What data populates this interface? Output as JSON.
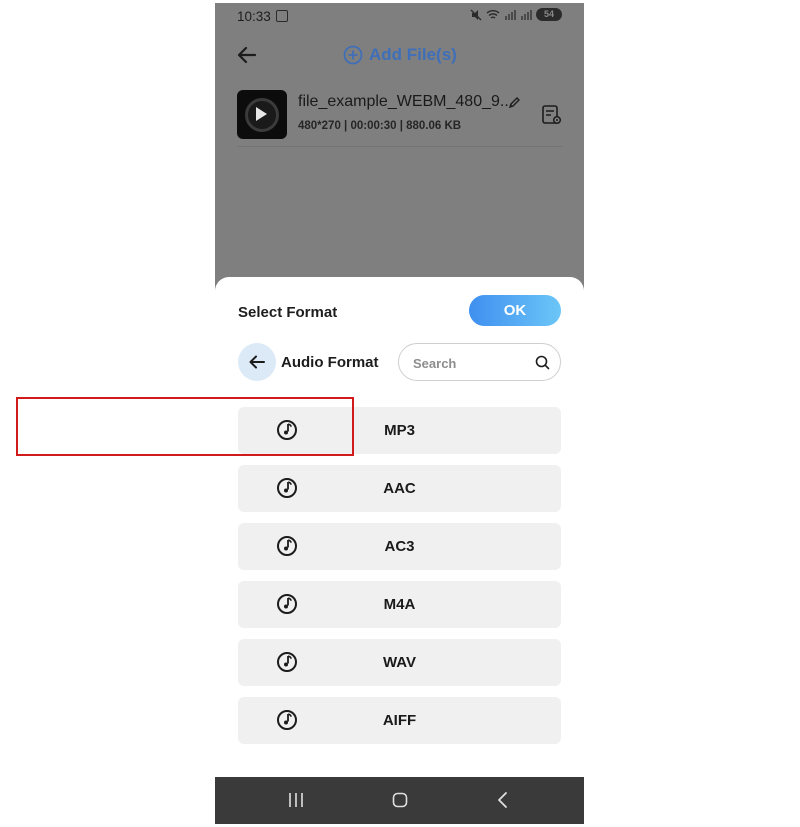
{
  "status_bar": {
    "time": "10:33",
    "battery": "54"
  },
  "header": {
    "add_files_label": "Add File(s)"
  },
  "file": {
    "name": "file_example_WEBM_480_9...",
    "resolution": "480*270",
    "duration": "00:00:30",
    "size": "880.06 KB",
    "meta_separator": " | "
  },
  "sheet": {
    "title": "Select Format",
    "ok_label": "OK",
    "category": "Audio Format",
    "search_placeholder": "Search"
  },
  "formats": [
    {
      "label": "MP3",
      "icon": "music-disc-icon",
      "selected": true
    },
    {
      "label": "AAC",
      "icon": "music-disc-icon"
    },
    {
      "label": "AC3",
      "icon": "music-disc-icon"
    },
    {
      "label": "M4A",
      "icon": "music-disc-icon"
    },
    {
      "label": "WAV",
      "icon": "music-disc-icon"
    },
    {
      "label": "AIFF",
      "icon": "music-disc-icon"
    }
  ],
  "colors": {
    "accent": "#3f8ff0",
    "highlight_border": "#d11a1a",
    "list_item_bg": "#f0f0f0"
  }
}
